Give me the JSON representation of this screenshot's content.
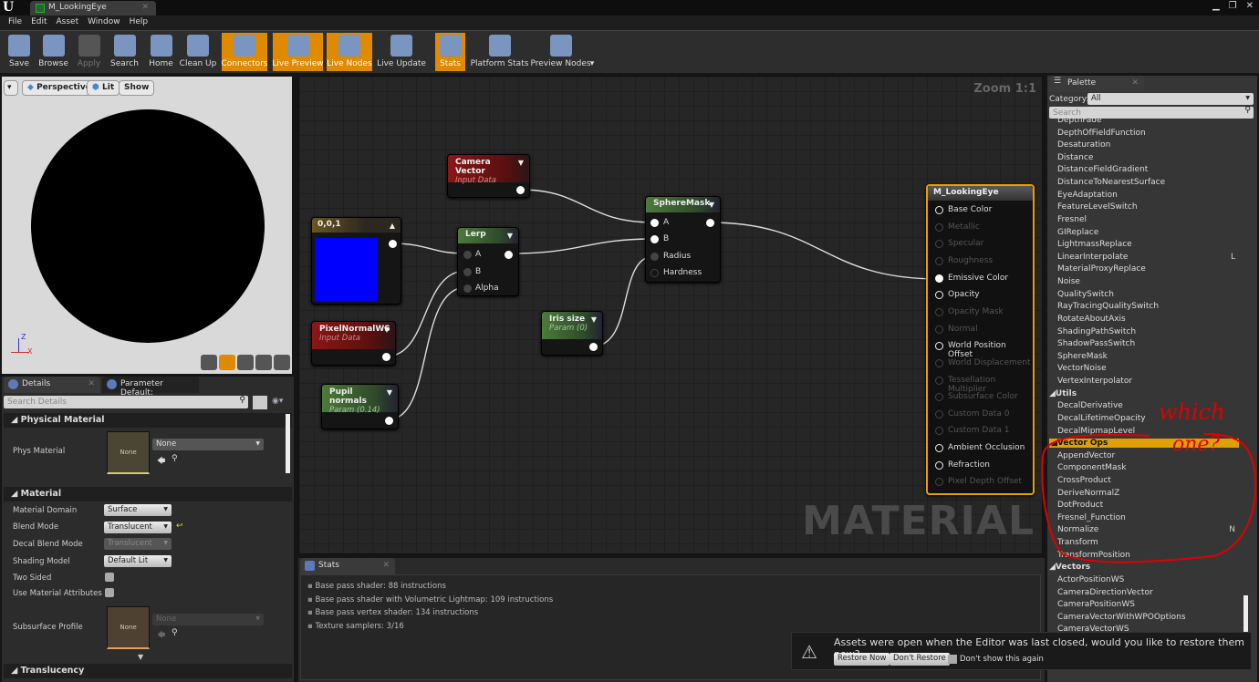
{
  "window": {
    "tab_title": "M_LookingEye",
    "logo": "U"
  },
  "menu": [
    "File",
    "Edit",
    "Asset",
    "Window",
    "Help"
  ],
  "toolbar": [
    {
      "label": "Save",
      "icon": "save-icon",
      "active": false
    },
    {
      "label": "Browse",
      "icon": "browse-icon",
      "active": false
    },
    {
      "label": "Apply",
      "icon": "apply-icon",
      "active": false
    },
    {
      "label": "Search",
      "icon": "search-icon",
      "active": false
    },
    {
      "label": "Home",
      "icon": "home-icon",
      "active": false
    },
    {
      "label": "Clean Up",
      "icon": "clean-up-icon",
      "active": false
    },
    {
      "label": "Connectors",
      "icon": "connectors-icon",
      "active": true
    },
    {
      "label": "Live Preview",
      "icon": "live-preview-icon",
      "active": true
    },
    {
      "label": "Live Nodes",
      "icon": "live-nodes-icon",
      "active": true
    },
    {
      "label": "Live Update",
      "icon": "live-update-icon",
      "active": false
    },
    {
      "label": "Stats",
      "icon": "stats-icon",
      "active": true
    },
    {
      "label": "Platform Stats",
      "icon": "platform-stats-icon",
      "active": false
    },
    {
      "label": "Preview Nodes",
      "icon": "preview-nodes-icon",
      "active": false
    }
  ],
  "viewport": {
    "perspective": "Perspective",
    "lit": "Lit",
    "show": "Show",
    "axis_z": "Z",
    "axis_x": "X"
  },
  "graph": {
    "zoom": "Zoom 1:1",
    "watermark": "MATERIAL",
    "nodes": {
      "camera": {
        "title": "Camera Vector",
        "sub": "Input Data"
      },
      "const": {
        "title": "0,0,1",
        "color": "#0000ff"
      },
      "lerp": {
        "title": "Lerp",
        "pins": [
          "A",
          "B",
          "Alpha"
        ]
      },
      "spheremask": {
        "title": "SphereMask",
        "pins": [
          "A",
          "B",
          "Radius",
          "Hardness"
        ]
      },
      "pixelnormal": {
        "title": "PixelNormalWS",
        "sub": "Input Data"
      },
      "pupil": {
        "title": "Pupil normals",
        "sub": "Param (0.14)"
      },
      "iris": {
        "title": "Iris size",
        "sub": "Param (0)"
      },
      "output": {
        "title": "M_LookingEye",
        "pins": [
          {
            "label": "Base Color",
            "enabled": true
          },
          {
            "label": "Metallic",
            "enabled": false
          },
          {
            "label": "Specular",
            "enabled": false
          },
          {
            "label": "Roughness",
            "enabled": false
          },
          {
            "label": "Emissive Color",
            "enabled": true,
            "connected": true
          },
          {
            "label": "Opacity",
            "enabled": true
          },
          {
            "label": "Opacity Mask",
            "enabled": false
          },
          {
            "label": "Normal",
            "enabled": false
          },
          {
            "label": "World Position Offset",
            "enabled": true
          },
          {
            "label": "World Displacement",
            "enabled": false
          },
          {
            "label": "Tessellation Multiplier",
            "enabled": false
          },
          {
            "label": "Subsurface Color",
            "enabled": false
          },
          {
            "label": "Custom Data 0",
            "enabled": false
          },
          {
            "label": "Custom Data 1",
            "enabled": false
          },
          {
            "label": "Ambient Occlusion",
            "enabled": true
          },
          {
            "label": "Refraction",
            "enabled": true
          },
          {
            "label": "Pixel Depth Offset",
            "enabled": false
          }
        ]
      }
    }
  },
  "details": {
    "tabs": [
      "Details",
      "Parameter Default:"
    ],
    "search_placeholder": "Search Details",
    "sections": {
      "physical": "Physical Material",
      "material": "Material",
      "translucency": "Translucency"
    },
    "phys_material": {
      "label": "Phys Material",
      "value": "None",
      "thumb": "None"
    },
    "props": [
      {
        "label": "Material Domain",
        "value": "Surface"
      },
      {
        "label": "Blend Mode",
        "value": "Translucent"
      },
      {
        "label": "Decal Blend Mode",
        "value": "Translucent"
      },
      {
        "label": "Shading Model",
        "value": "Default Lit"
      }
    ],
    "two_sided": {
      "label": "Two Sided",
      "checked": false
    },
    "use_attrs": {
      "label": "Use Material Attributes",
      "checked": false
    },
    "subsurface": {
      "label": "Subsurface Profile",
      "value": "None",
      "thumb": "None"
    }
  },
  "stats": {
    "tab": "Stats",
    "lines": [
      "Base pass shader: 88 instructions",
      "Base pass shader with Volumetric Lightmap: 109 instructions",
      "Base pass vertex shader: 134 instructions",
      "Texture samplers: 3/16"
    ]
  },
  "palette": {
    "tab": "Palette",
    "category_label": "Category:",
    "category_value": "All",
    "search_placeholder": "Search",
    "items": [
      {
        "t": "item",
        "label": "DepthFade"
      },
      {
        "t": "item",
        "label": "DepthOfFieldFunction"
      },
      {
        "t": "item",
        "label": "Desaturation"
      },
      {
        "t": "item",
        "label": "Distance"
      },
      {
        "t": "item",
        "label": "DistanceFieldGradient"
      },
      {
        "t": "item",
        "label": "DistanceToNearestSurface"
      },
      {
        "t": "item",
        "label": "EyeAdaptation"
      },
      {
        "t": "item",
        "label": "FeatureLevelSwitch"
      },
      {
        "t": "item",
        "label": "Fresnel"
      },
      {
        "t": "item",
        "label": "GIReplace"
      },
      {
        "t": "item",
        "label": "LightmassReplace"
      },
      {
        "t": "item",
        "label": "LinearInterpolate",
        "key": "L"
      },
      {
        "t": "item",
        "label": "MaterialProxyReplace"
      },
      {
        "t": "item",
        "label": "Noise"
      },
      {
        "t": "item",
        "label": "QualitySwitch"
      },
      {
        "t": "item",
        "label": "RayTracingQualitySwitch"
      },
      {
        "t": "item",
        "label": "RotateAboutAxis"
      },
      {
        "t": "item",
        "label": "ShadingPathSwitch"
      },
      {
        "t": "item",
        "label": "ShadowPassSwitch"
      },
      {
        "t": "item",
        "label": "SphereMask"
      },
      {
        "t": "item",
        "label": "VectorNoise"
      },
      {
        "t": "item",
        "label": "VertexInterpolator"
      },
      {
        "t": "cat",
        "label": "Utils"
      },
      {
        "t": "item",
        "label": "DecalDerivative"
      },
      {
        "t": "item",
        "label": "DecalLifetimeOpacity"
      },
      {
        "t": "item",
        "label": "DecalMipmapLevel"
      },
      {
        "t": "cat",
        "label": "Vector Ops",
        "selected": true
      },
      {
        "t": "item",
        "label": "AppendVector"
      },
      {
        "t": "item",
        "label": "ComponentMask"
      },
      {
        "t": "item",
        "label": "CrossProduct"
      },
      {
        "t": "item",
        "label": "DeriveNormalZ"
      },
      {
        "t": "item",
        "label": "DotProduct"
      },
      {
        "t": "item",
        "label": "Fresnel_Function"
      },
      {
        "t": "item",
        "label": "Normalize",
        "key": "N"
      },
      {
        "t": "item",
        "label": "Transform"
      },
      {
        "t": "item",
        "label": "TransformPosition"
      },
      {
        "t": "cat",
        "label": "Vectors"
      },
      {
        "t": "item",
        "label": "ActorPositionWS"
      },
      {
        "t": "item",
        "label": "CameraDirectionVector"
      },
      {
        "t": "item",
        "label": "CameraPositionWS"
      },
      {
        "t": "item",
        "label": "CameraVectorWithWPOOptions"
      },
      {
        "t": "item",
        "label": "CameraVectorWS"
      }
    ]
  },
  "annotation": {
    "text": "which one?",
    "color": "#e00000"
  },
  "notification": {
    "message": "Assets were open when the Editor was last closed, would you like to restore them now?",
    "restore": "Restore Now",
    "dont_restore": "Don't Restore",
    "dont_show": "Don't show this again"
  },
  "colors": {
    "accent": "#e08a00",
    "selection": "#e0a000"
  }
}
